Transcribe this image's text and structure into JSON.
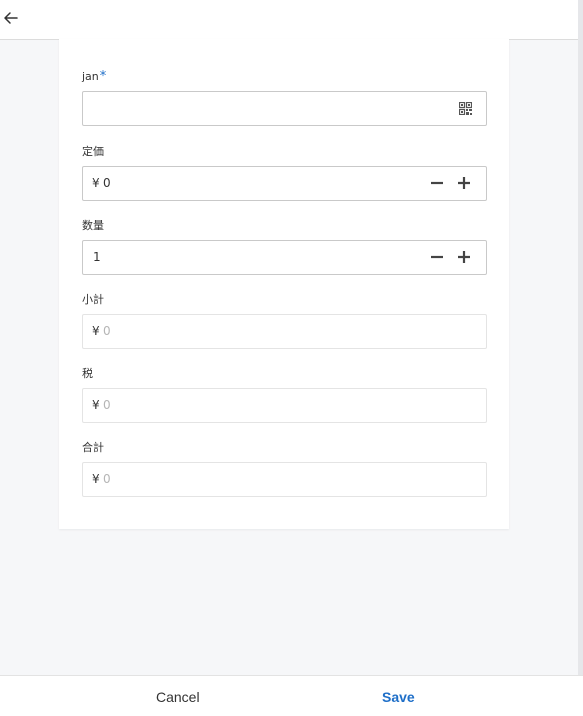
{
  "header": {
    "back_icon": "arrow-left-icon"
  },
  "form": {
    "jan": {
      "label": "jan",
      "required_mark": "*",
      "value": "",
      "scan_icon": "qr-code-icon"
    },
    "list_price": {
      "label": "定価",
      "currency": "¥",
      "value": "0"
    },
    "quantity": {
      "label": "数量",
      "value": "1"
    },
    "subtotal": {
      "label": "小計",
      "currency": "¥",
      "value": "0"
    },
    "tax": {
      "label": "税",
      "currency": "¥",
      "value": "0"
    },
    "total": {
      "label": "合計",
      "currency": "¥",
      "value": "0"
    }
  },
  "footer": {
    "cancel_label": "Cancel",
    "save_label": "Save"
  },
  "colors": {
    "accent": "#1f6fc8",
    "background": "#f6f7f9"
  }
}
